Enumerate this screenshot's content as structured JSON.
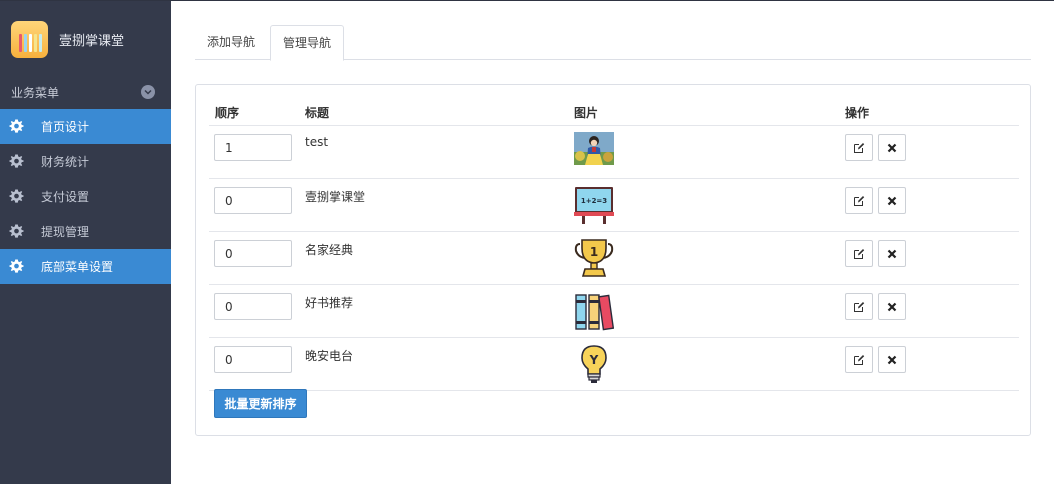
{
  "brand": {
    "name": "壹捌掌课堂"
  },
  "sidebar": {
    "section_title": "业务菜单",
    "items": [
      {
        "label": "首页设计",
        "active": true
      },
      {
        "label": "财务统计",
        "active": false
      },
      {
        "label": "支付设置",
        "active": false
      },
      {
        "label": "提现管理",
        "active": false
      },
      {
        "label": "底部菜单设置",
        "active": true
      }
    ]
  },
  "tabs": [
    {
      "label": "添加导航",
      "active": false
    },
    {
      "label": "管理导航",
      "active": true
    }
  ],
  "table": {
    "headers": {
      "order": "顺序",
      "title": "标题",
      "image": "图片",
      "actions": "操作"
    },
    "rows": [
      {
        "order": "1",
        "title": "test",
        "image": "photo-thumbnail"
      },
      {
        "order": "0",
        "title": "壹捌掌课堂",
        "image": "blackboard-icon"
      },
      {
        "order": "0",
        "title": "名家经典",
        "image": "trophy-icon"
      },
      {
        "order": "0",
        "title": "好书推荐",
        "image": "books-icon"
      },
      {
        "order": "0",
        "title": "晚安电台",
        "image": "lightbulb-icon"
      }
    ]
  },
  "blackboard_text": "1+2=3",
  "trophy_text": "1",
  "bulb_text": "Y",
  "batch_button": "批量更新排序",
  "colors": {
    "sidebar_bg": "#343a4b",
    "accent": "#3a8ad3"
  }
}
